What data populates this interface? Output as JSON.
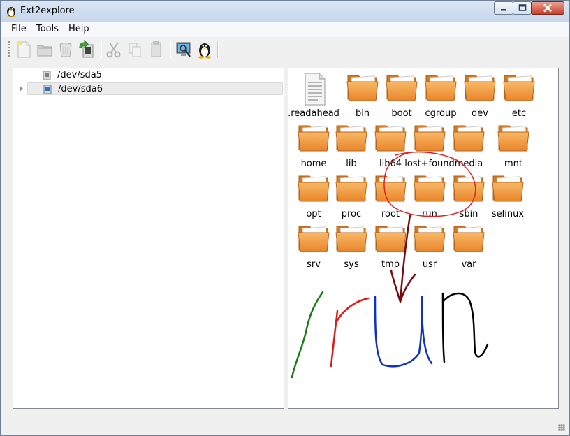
{
  "window": {
    "title": "Ext2explore",
    "icon": "tux-icon"
  },
  "menu": [
    "File",
    "Tools",
    "Help"
  ],
  "toolbar": [
    {
      "name": "new-file-button",
      "icon": "new-document-icon"
    },
    {
      "name": "open-folder-button",
      "icon": "folder-icon"
    },
    {
      "name": "delete-button",
      "icon": "trash-icon"
    },
    {
      "name": "save-button",
      "icon": "save-arrow-icon"
    },
    {
      "name": "cut-button",
      "icon": "scissors-icon"
    },
    {
      "name": "copy-button",
      "icon": "copy-icon"
    },
    {
      "name": "paste-button",
      "icon": "paste-icon"
    },
    {
      "name": "properties-button",
      "icon": "monitor-icon"
    },
    {
      "name": "about-button",
      "icon": "tux-icon"
    }
  ],
  "tree": [
    {
      "label": "/dev/sda5",
      "expandable": false,
      "selected": false
    },
    {
      "label": "/dev/sda6",
      "expandable": true,
      "selected": true
    }
  ],
  "files": [
    {
      "name": ".readahead",
      "type": "file"
    },
    {
      "name": "bin",
      "type": "folder"
    },
    {
      "name": "boot",
      "type": "folder"
    },
    {
      "name": "cgroup",
      "type": "folder"
    },
    {
      "name": "dev",
      "type": "folder"
    },
    {
      "name": "etc",
      "type": "folder"
    },
    {
      "name": "home",
      "type": "folder"
    },
    {
      "name": "lib",
      "type": "folder"
    },
    {
      "name": "lib64",
      "type": "folder"
    },
    {
      "name": "lost+found",
      "type": "folder"
    },
    {
      "name": "media",
      "type": "folder"
    },
    {
      "name": "mnt",
      "type": "folder"
    },
    {
      "name": "opt",
      "type": "folder"
    },
    {
      "name": "proc",
      "type": "folder"
    },
    {
      "name": "root",
      "type": "folder"
    },
    {
      "name": "run",
      "type": "folder"
    },
    {
      "name": "sbin",
      "type": "folder"
    },
    {
      "name": "selinux",
      "type": "folder"
    },
    {
      "name": "srv",
      "type": "folder"
    },
    {
      "name": "sys",
      "type": "folder"
    },
    {
      "name": "tmp",
      "type": "folder"
    },
    {
      "name": "usr",
      "type": "folder"
    },
    {
      "name": "var",
      "type": "folder"
    }
  ],
  "annotation": {
    "text": "run",
    "circle_color": "#e02020",
    "arrow_color": "#7a0a0a",
    "letter_colors": [
      "#1a7a1a",
      "#e01818",
      "#1030c0",
      "#000000"
    ]
  }
}
